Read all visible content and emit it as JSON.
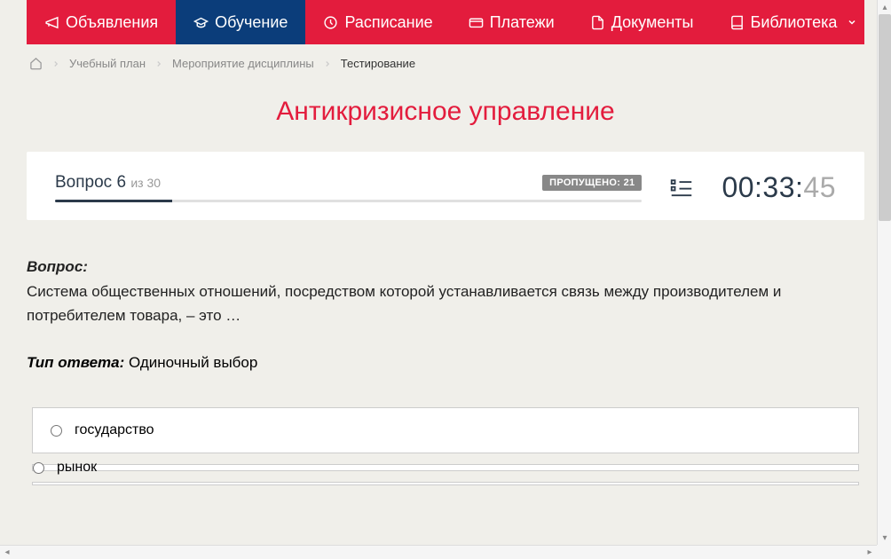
{
  "nav": {
    "items": [
      {
        "label": "Объявления",
        "icon": "megaphone"
      },
      {
        "label": "Обучение",
        "icon": "graduation",
        "active": true
      },
      {
        "label": "Расписание",
        "icon": "clock"
      },
      {
        "label": "Платежи",
        "icon": "card"
      },
      {
        "label": "Документы",
        "icon": "document"
      },
      {
        "label": "Библиотека",
        "icon": "book",
        "dropdown": true
      }
    ]
  },
  "breadcrumb": {
    "items": [
      "Учебный план",
      "Мероприятие дисциплины",
      "Тестирование"
    ]
  },
  "page_title": "Антикризисное управление",
  "status": {
    "question_word": "Вопрос",
    "question_num": "6",
    "of_word": "из",
    "total": "30",
    "skipped_label": "ПРОПУЩЕНО: 21",
    "progress_percent": 20
  },
  "timer": {
    "main": "00:33:",
    "seconds": "45"
  },
  "question": {
    "label": "Вопрос:",
    "text": "Система общественных отношений, посредством которой устанавливается связь между производителем и потребителем товара, – это …"
  },
  "answer_type": {
    "label": "Тип ответа:",
    "value": "Одиночный выбор"
  },
  "options": [
    "государство",
    "рынок"
  ]
}
